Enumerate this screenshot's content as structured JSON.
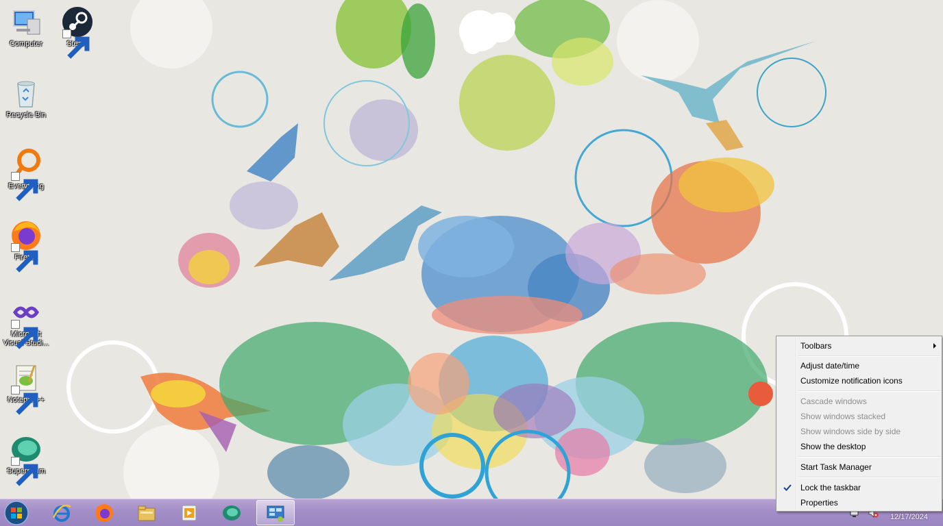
{
  "desktop": {
    "icons": [
      {
        "label": "Computer",
        "icon": "computer-icon",
        "shortcut": false
      },
      {
        "label": "Steam",
        "icon": "steam-icon",
        "shortcut": true
      },
      {
        "label": "Recycle Bin",
        "icon": "recycle-bin-icon",
        "shortcut": false
      },
      {
        "label": "Everything",
        "icon": "everything-icon",
        "shortcut": true
      },
      {
        "label": "Firefox",
        "icon": "firefox-icon",
        "shortcut": true
      },
      {
        "label": "Microsoft Visual Studi...",
        "icon": "visual-studio-icon",
        "shortcut": true
      },
      {
        "label": "Notepad++",
        "icon": "notepadpp-icon",
        "shortcut": true
      },
      {
        "label": "Supermium",
        "icon": "supermium-icon",
        "shortcut": true
      }
    ]
  },
  "taskbar": {
    "start": "start-orb-icon",
    "pinned": [
      {
        "name": "internet-explorer-icon"
      },
      {
        "name": "firefox-icon"
      },
      {
        "name": "file-explorer-icon"
      },
      {
        "name": "media-player-icon"
      },
      {
        "name": "supermium-icon"
      },
      {
        "name": "control-panel-icon",
        "active": true
      }
    ],
    "clock": {
      "date": "12/17/2024"
    },
    "colors": {
      "taskbar": "#a58fc8"
    }
  },
  "context_menu": {
    "items": [
      {
        "label": "Toolbars",
        "enabled": true,
        "submenu": true
      },
      {
        "label": "Adjust date/time",
        "enabled": true
      },
      {
        "label": "Customize notification icons",
        "enabled": true
      },
      {
        "label": "Cascade windows",
        "enabled": false
      },
      {
        "label": "Show windows stacked",
        "enabled": false
      },
      {
        "label": "Show windows side by side",
        "enabled": false
      },
      {
        "label": "Show the desktop",
        "enabled": true
      },
      {
        "label": "Start Task Manager",
        "enabled": true
      },
      {
        "label": "Lock the taskbar",
        "enabled": true,
        "checked": true
      },
      {
        "label": "Properties",
        "enabled": true
      }
    ]
  }
}
